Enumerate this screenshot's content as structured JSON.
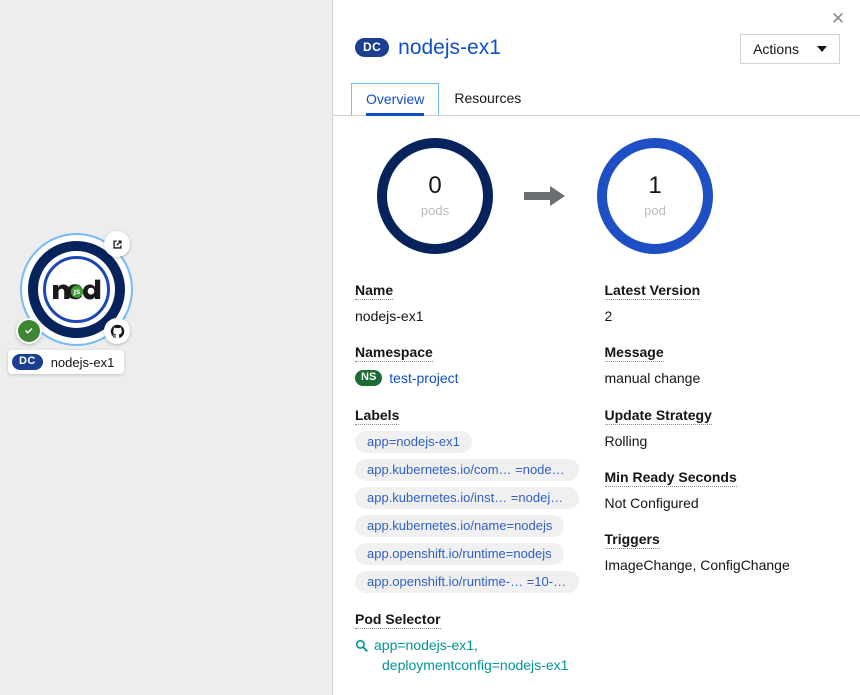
{
  "topology": {
    "node": {
      "label": "nodejs-ex1",
      "kind_abbrev": "DC",
      "logo_name": "nodejs-logo",
      "badges": {
        "external_link": "external-link-icon",
        "status": "check-circle-icon",
        "source": "github-icon"
      }
    }
  },
  "panel": {
    "close_label": "✕",
    "kind_abbrev": "DC",
    "resource_name": "nodejs-ex1",
    "actions_label": "Actions",
    "tabs": [
      {
        "label": "Overview",
        "active": true
      },
      {
        "label": "Resources",
        "active": false
      }
    ]
  },
  "overview": {
    "pod_rings": {
      "from": {
        "count": "0",
        "unit": "pods",
        "color": "#06235b"
      },
      "to": {
        "count": "1",
        "unit": "pod",
        "color": "#1f4fc4"
      },
      "arrow_icon": "arrow-right-icon"
    },
    "left_fields": {
      "name": {
        "label": "Name",
        "value": "nodejs-ex1"
      },
      "namespace": {
        "label": "Namespace",
        "kind_abbrev": "NS",
        "value": "test-project"
      },
      "labels": {
        "label": "Labels",
        "items": [
          "app=nodejs-ex1",
          "app.kubernetes.io/com… =nodejs…",
          "app.kubernetes.io/inst… =nodejs-…",
          "app.kubernetes.io/name=nodejs",
          "app.openshift.io/runtime=nodejs",
          "app.openshift.io/runtime-… =10-S…"
        ]
      },
      "pod_selector": {
        "label": "Pod Selector",
        "icon": "search-icon",
        "line1": "app=nodejs-ex1,",
        "line2": "deploymentconfig=nodejs-ex1"
      }
    },
    "right_fields": {
      "latest_version": {
        "label": "Latest Version",
        "value": "2"
      },
      "message": {
        "label": "Message",
        "value": "manual change"
      },
      "update_strategy": {
        "label": "Update Strategy",
        "value": "Rolling"
      },
      "min_ready_seconds": {
        "label": "Min Ready Seconds",
        "value": "Not Configured"
      },
      "triggers": {
        "label": "Triggers",
        "value": "ImageChange, ConfigChange"
      }
    }
  },
  "colors": {
    "link": "#0f50c7",
    "teal": "#009596",
    "namespace_green": "#1b6b34",
    "dc_navy": "#1c3f94",
    "canvas_bg": "#ededed"
  }
}
